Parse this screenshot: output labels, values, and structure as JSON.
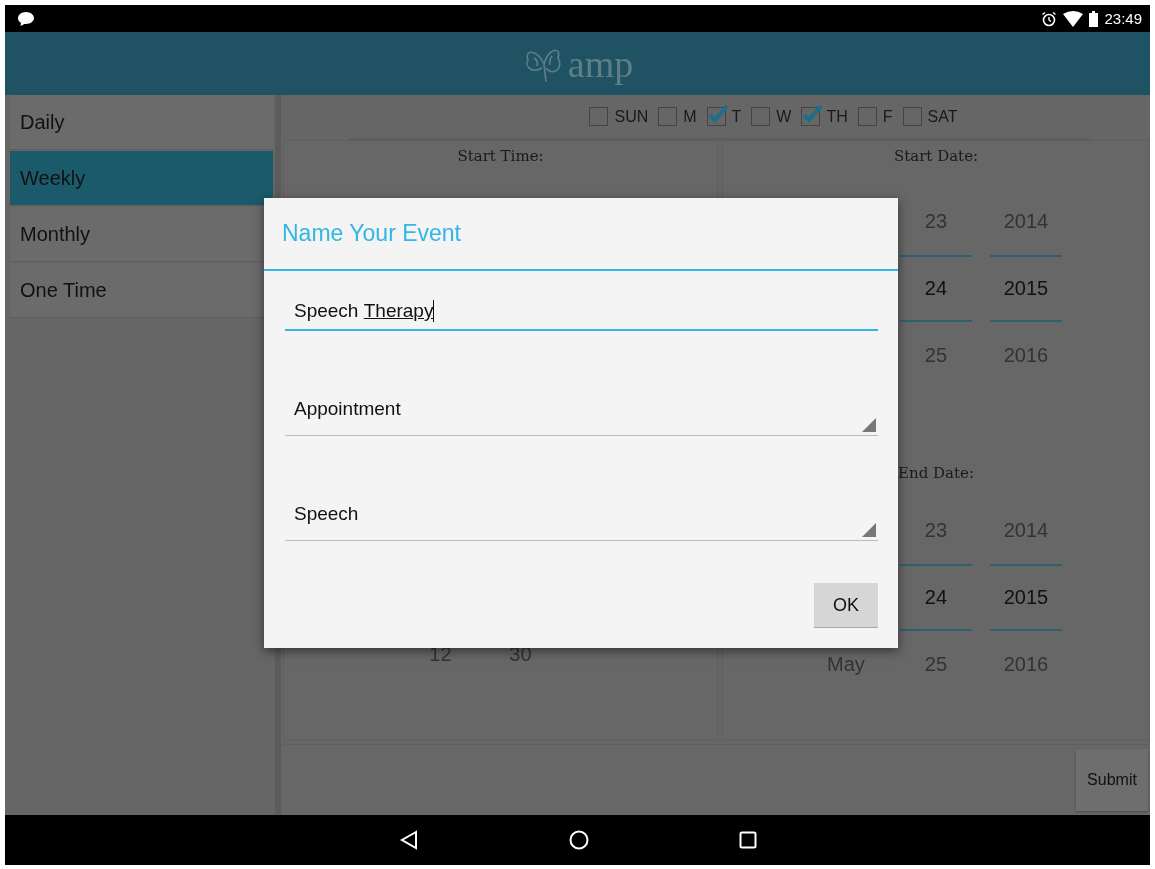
{
  "status_bar": {
    "time": "23:49"
  },
  "app_bar": {
    "title": "amp"
  },
  "sidebar": {
    "items": [
      {
        "label": "Daily",
        "selected": false
      },
      {
        "label": "Weekly",
        "selected": true
      },
      {
        "label": "Monthly",
        "selected": false
      },
      {
        "label": "One Time",
        "selected": false
      }
    ]
  },
  "days": [
    {
      "label": "SUN",
      "checked": false
    },
    {
      "label": "M",
      "checked": false
    },
    {
      "label": "T",
      "checked": true
    },
    {
      "label": "W",
      "checked": false
    },
    {
      "label": "TH",
      "checked": true
    },
    {
      "label": "F",
      "checked": false
    },
    {
      "label": "SAT",
      "checked": false
    }
  ],
  "start_time": {
    "label": "Start Time:",
    "hour": "12",
    "minute": "30"
  },
  "start_date": {
    "label": "Start Date:",
    "days": [
      "23",
      "24",
      "25"
    ],
    "years": [
      "2014",
      "2015",
      "2016"
    ]
  },
  "end_date": {
    "label": "End Date:",
    "month": "May",
    "days": [
      "23",
      "24",
      "25"
    ],
    "years": [
      "2014",
      "2015",
      "2016"
    ]
  },
  "submit": "Submit",
  "dialog": {
    "title": "Name Your Event",
    "name_field": {
      "value": "Speech",
      "composing": "Therapy"
    },
    "spinners": [
      {
        "value": "Appointment"
      },
      {
        "value": "Speech"
      }
    ],
    "ok": "OK"
  }
}
